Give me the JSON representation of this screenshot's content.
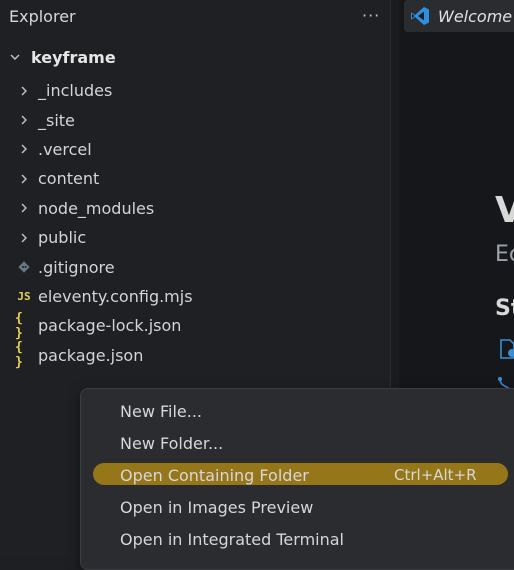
{
  "explorer": {
    "title": "Explorer",
    "more_icon": "more-horizontal-icon",
    "root_folder": "keyframe"
  },
  "tree": [
    {
      "label": "_includes",
      "kind": "folder",
      "icon": "chevron-right-icon"
    },
    {
      "label": "_site",
      "kind": "folder",
      "icon": "chevron-right-icon"
    },
    {
      "label": ".vercel",
      "kind": "folder",
      "icon": "chevron-right-icon"
    },
    {
      "label": "content",
      "kind": "folder",
      "icon": "chevron-right-icon"
    },
    {
      "label": "node_modules",
      "kind": "folder",
      "icon": "chevron-right-icon"
    },
    {
      "label": "public",
      "kind": "folder",
      "icon": "chevron-right-icon"
    },
    {
      "label": ".gitignore",
      "kind": "file",
      "icon": "git-icon"
    },
    {
      "label": "eleventy.config.mjs",
      "kind": "file",
      "icon": "js-icon",
      "icon_text": "JS"
    },
    {
      "label": "package-lock.json",
      "kind": "file",
      "icon": "json-icon",
      "icon_text": "{ }"
    },
    {
      "label": "package.json",
      "kind": "file",
      "icon": "json-icon",
      "icon_text": "{ }"
    }
  ],
  "editor": {
    "tab_label": "Welcome",
    "tab_icon": "vscode-icon",
    "heading_fragment": "V",
    "subheading_fragment": "Ec",
    "section_fragment": "St"
  },
  "context_menu": {
    "items": [
      {
        "label": "New File...",
        "shortcut": ""
      },
      {
        "label": "New Folder...",
        "shortcut": ""
      },
      {
        "label": "Open Containing Folder",
        "shortcut": "Ctrl+Alt+R",
        "highlighted": true
      },
      {
        "label": "Open in Images Preview",
        "shortcut": ""
      },
      {
        "label": "Open in Integrated Terminal",
        "shortcut": ""
      }
    ]
  },
  "colors": {
    "background": "#1e1f22",
    "menu_background": "#2a2c30",
    "highlight": "#a88516",
    "icon_yellow": "#e9d34a",
    "link_blue": "#3a8fd6"
  }
}
